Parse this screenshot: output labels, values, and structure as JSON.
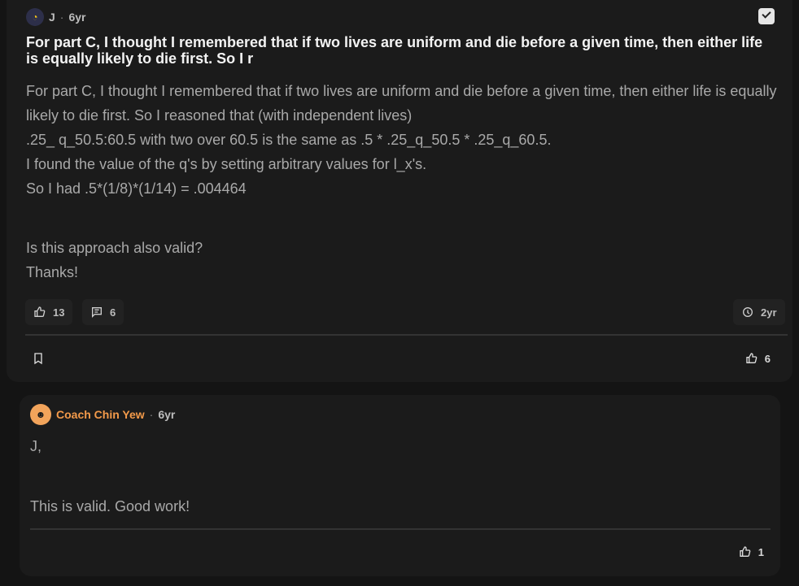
{
  "post": {
    "author": "J",
    "author_avatar_icon": "pacman-icon",
    "age": "6yr",
    "title": "For part C, I thought I remembered that if two lives are uniform and die before a given time, then either life is equally likely to die first. So I r",
    "body_lines": [
      "For part C, I thought I remembered that if two lives are uniform and die before a given time, then either life is equally likely to die first. So I reasoned that (with independent lives)",
      ".25_ q_50.5:60.5 with two over 60.5 is the same as .5 * .25_q_50.5 * .25_q_60.5.",
      "I found the value of the q's by setting arbitrary values for l_x's.",
      "So I had .5*(1/8)*(1/14) = .004464"
    ],
    "question_lines": [
      "Is this approach also valid?",
      "Thanks!"
    ],
    "likes": "13",
    "comments": "6",
    "history": "2yr",
    "bottom_likes": "6"
  },
  "reply": {
    "author": "Coach Chin Yew",
    "age": "6yr",
    "lines": [
      "J,",
      "This is valid. Good work!"
    ],
    "likes": "1"
  }
}
